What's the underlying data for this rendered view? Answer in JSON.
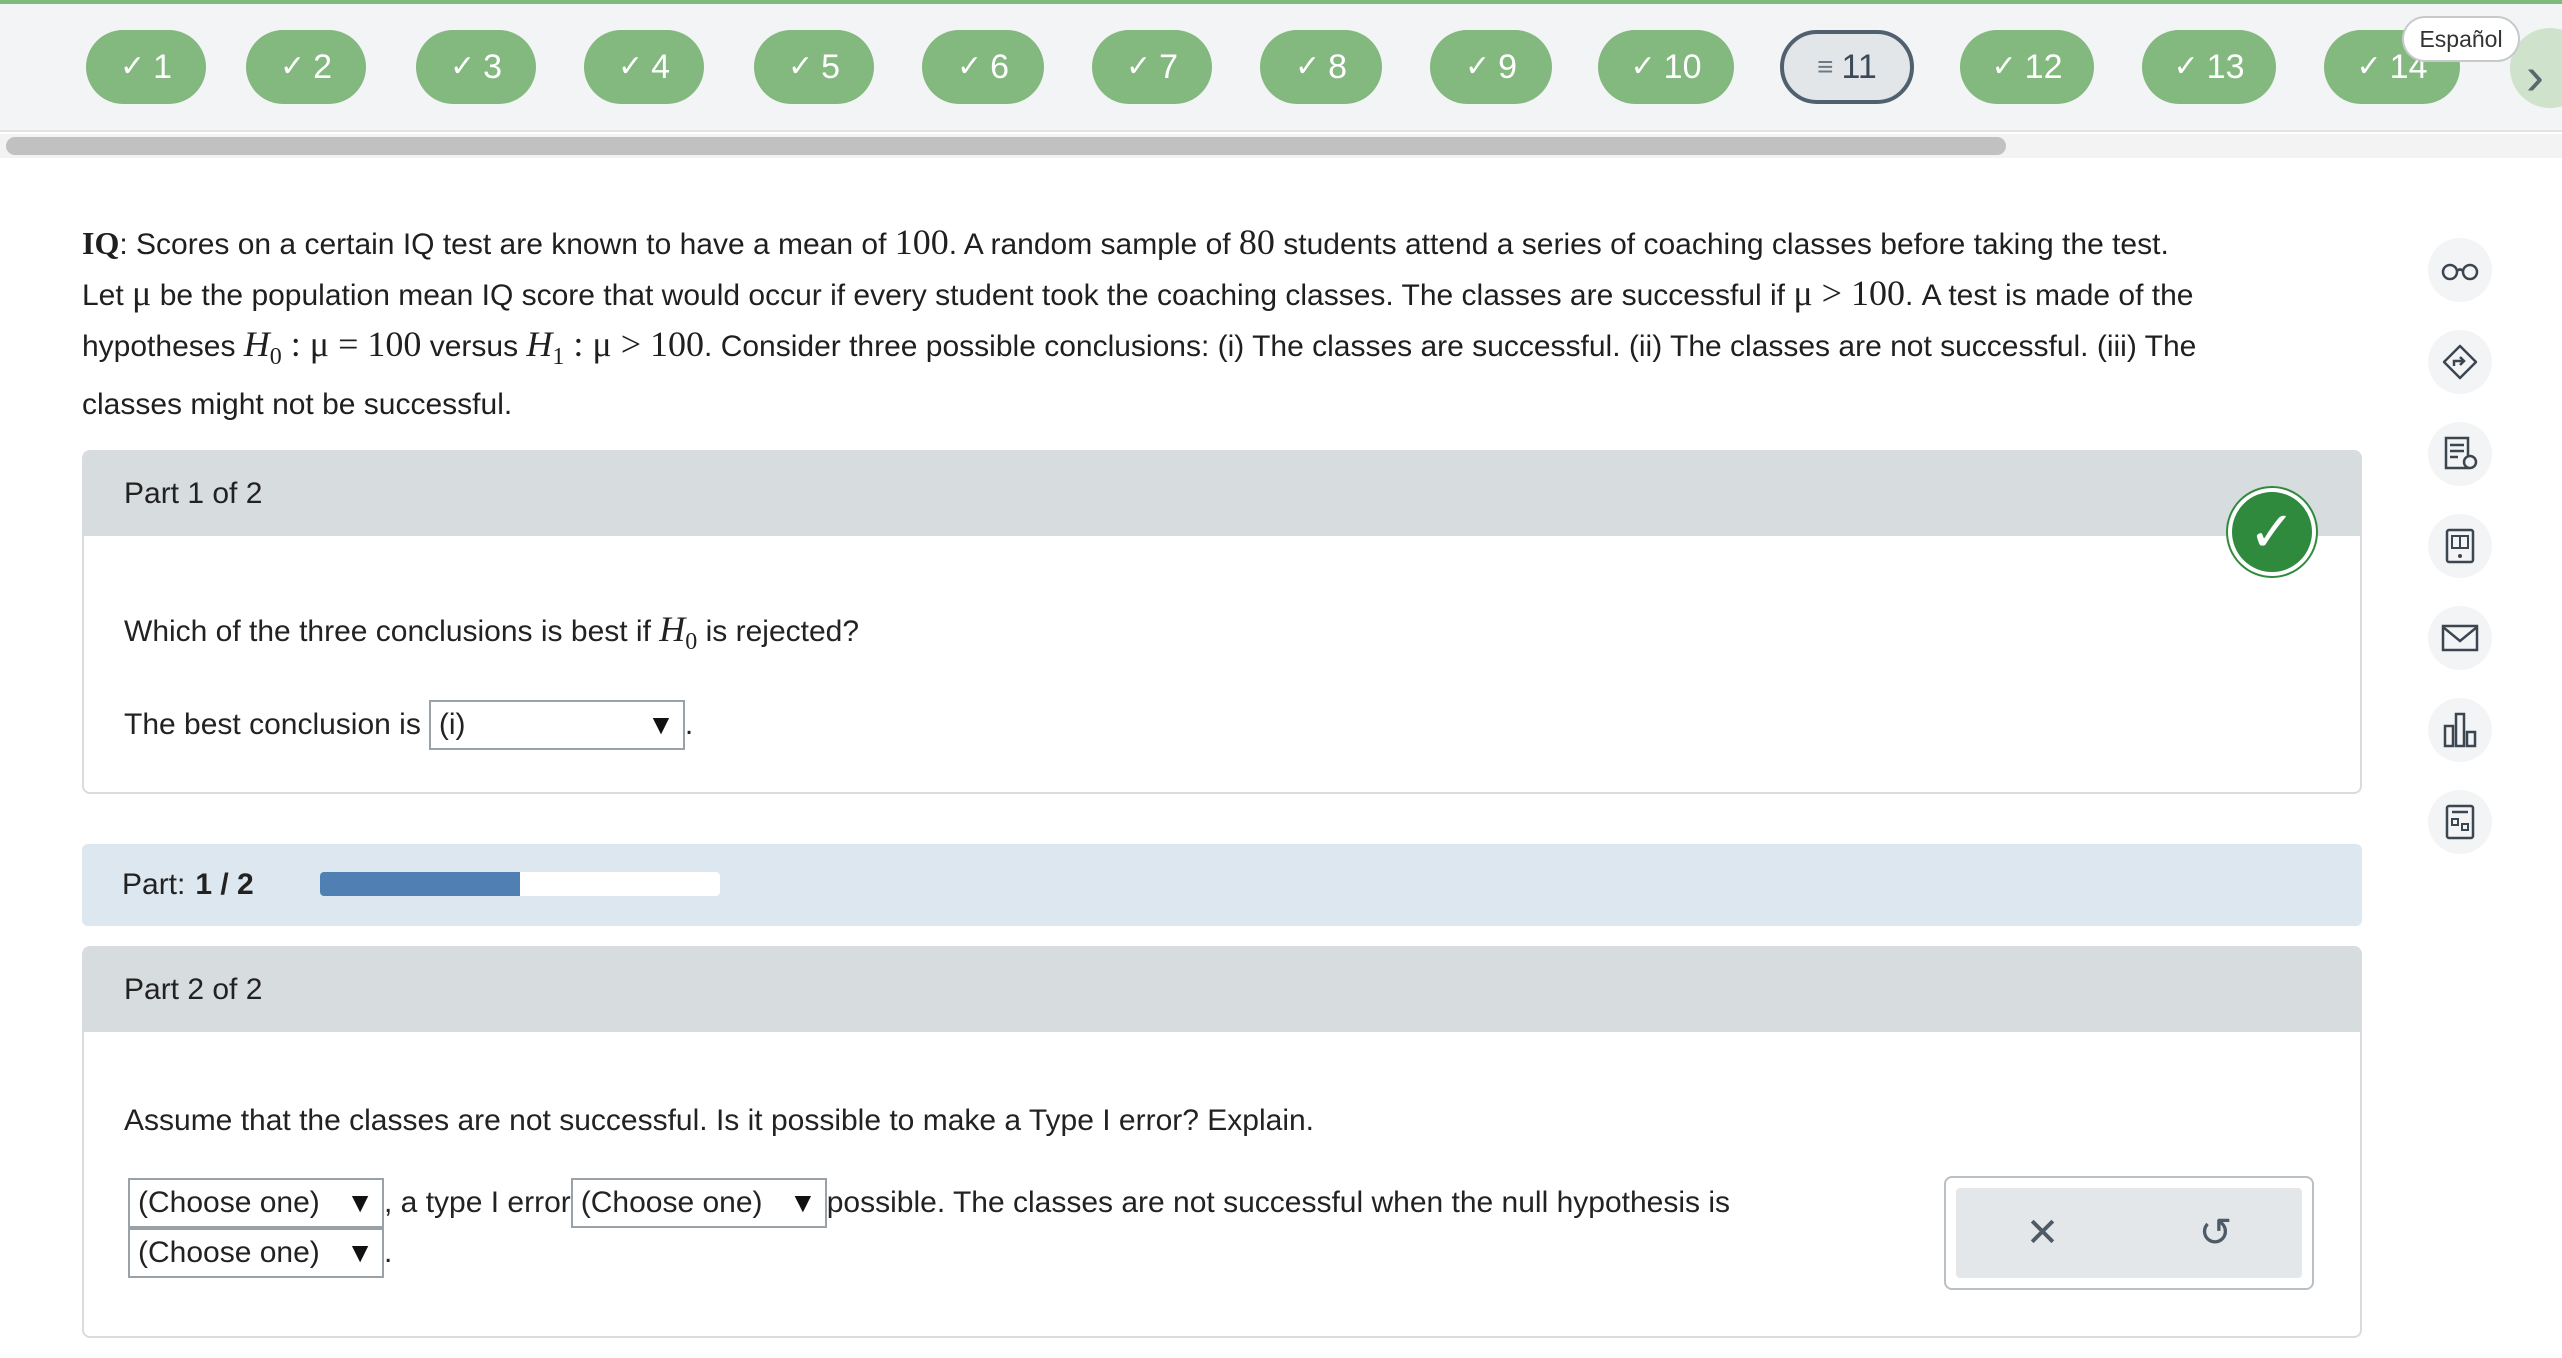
{
  "nav": {
    "questions": [
      {
        "label": "1",
        "state": "done"
      },
      {
        "label": "2",
        "state": "done"
      },
      {
        "label": "3",
        "state": "done"
      },
      {
        "label": "4",
        "state": "done"
      },
      {
        "label": "5",
        "state": "done"
      },
      {
        "label": "6",
        "state": "done"
      },
      {
        "label": "7",
        "state": "done"
      },
      {
        "label": "8",
        "state": "done"
      },
      {
        "label": "9",
        "state": "done"
      },
      {
        "label": "10",
        "state": "done"
      },
      {
        "label": "11",
        "state": "current"
      },
      {
        "label": "12",
        "state": "done"
      },
      {
        "label": "13",
        "state": "done"
      },
      {
        "label": "14",
        "state": "done"
      }
    ],
    "check_glyph": "✓",
    "current_glyph": "≡",
    "language_label": "Español",
    "next_arrow": "›"
  },
  "problem": {
    "heading": "IQ",
    "sentence1a": ": Scores on a certain IQ test are known to have a mean of ",
    "mean": "100",
    "sentence1b": ". A random sample of ",
    "n": "80",
    "sentence1c": " students attend a series of coaching classes before taking the test.",
    "sentence2a": "Let ",
    "mu": "μ",
    "sentence2b": " be the population mean IQ score that would occur if every student took the coaching classes. The classes are successful if ",
    "cond": "μ > 100",
    "sentence2c": ". A test is made of the",
    "sentence3a": "hypotheses ",
    "h0": "H",
    "h0sub": "0",
    "h0rest": " : μ = 100",
    "versus": " versus ",
    "h1": "H",
    "h1sub": "1",
    "h1rest": " : μ > 100",
    "sentence3b": ". Consider three possible conclusions: (i) The classes are successful. (ii) The classes are not successful. (iii) The",
    "sentence4": "classes might not be successful."
  },
  "part1": {
    "header": "Part 1 of 2",
    "question_a": "Which of the three conclusions is best if ",
    "question_h": "H",
    "question_sub": "0",
    "question_b": " is rejected?",
    "answer_label": "The best conclusion is ",
    "answer_value": "(i)",
    "answer_suffix": ".",
    "status": "correct"
  },
  "progress": {
    "label": "Part:",
    "value": "1 / 2",
    "fraction": 0.5
  },
  "part2": {
    "header": "Part 2 of 2",
    "question": "Assume that the classes are not successful. Is it possible to make a Type I error? Explain.",
    "select1": "(Choose one)",
    "text1": ", a type I error ",
    "select2": "(Choose one)",
    "text2": " possible. The classes are not successful when the null hypothesis is",
    "select3": "(Choose one)",
    "text3": " ."
  },
  "actions": {
    "clear_glyph": "✕",
    "undo_glyph": "↺"
  },
  "tools": [
    {
      "icon": "glasses-icon"
    },
    {
      "icon": "direction-sign-icon"
    },
    {
      "icon": "document-hint-icon"
    },
    {
      "icon": "ebook-icon"
    },
    {
      "icon": "mail-icon"
    },
    {
      "icon": "bar-chart-icon"
    },
    {
      "icon": "calculator-icon"
    }
  ]
}
